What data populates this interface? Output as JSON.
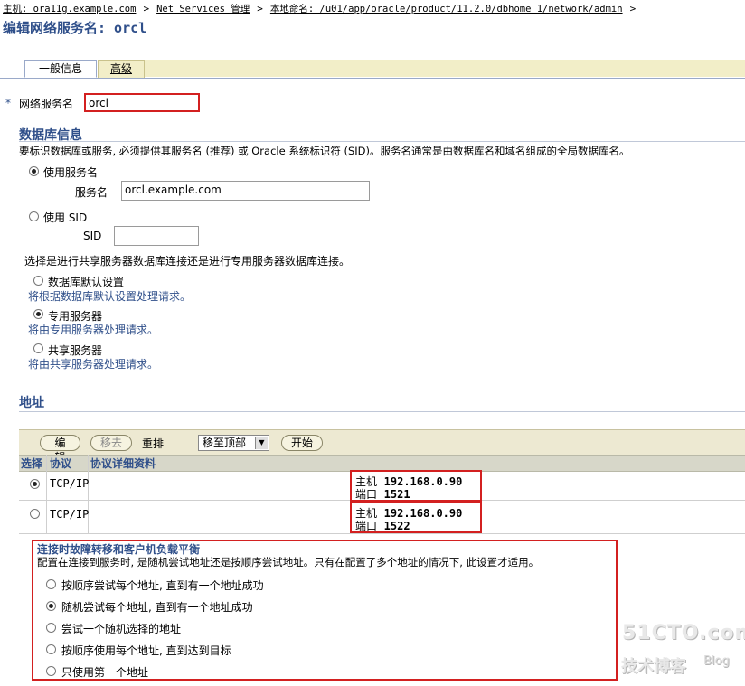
{
  "breadcrumb": {
    "host": "主机: ora11g.example.com",
    "netservices": "Net Services 管理",
    "naming": "本地命名: /u01/app/oracle/product/11.2.0/dbhome_1/network/admin",
    "sep": ">"
  },
  "page_title": "编辑网络服务名: orcl",
  "tabs": {
    "general": "一般信息",
    "advanced": "高级"
  },
  "service": {
    "required_mark": "*",
    "label": "网络服务名",
    "value": "orcl"
  },
  "db_info": {
    "title": "数据库信息",
    "description": "要标识数据库或服务, 必须提供其服务名 (推荐) 或 Oracle 系统标识符 (SID)。服务名通常是由数据库名和域名组成的全局数据库名。",
    "use_service_name": "使用服务名",
    "service_name_label": "服务名",
    "service_name_value": "orcl.example.com",
    "use_sid": "使用 SID",
    "sid_label": "SID",
    "sid_value": "",
    "connection_prompt": "选择是进行共享服务器数据库连接还是进行专用服务器数据库连接。",
    "options": [
      {
        "label": "数据库默认设置",
        "hint": "将根据数据库默认设置处理请求。",
        "selected": false
      },
      {
        "label": "专用服务器",
        "hint": "将由专用服务器处理请求。",
        "selected": true
      },
      {
        "label": "共享服务器",
        "hint": "将由共享服务器处理请求。",
        "selected": false
      }
    ]
  },
  "address": {
    "title": "地址",
    "toolbar": {
      "edit": "编辑",
      "remove": "移去",
      "reorder_label": "重排",
      "reorder_value": "移至顶部",
      "start": "开始"
    },
    "columns": [
      "选择",
      "协议",
      "协议详细资料"
    ],
    "rows": [
      {
        "protocol": "TCP/IP",
        "host_label": "主机",
        "host": "192.168.0.90",
        "port_label": "端口",
        "port": "1521",
        "selected": true
      },
      {
        "protocol": "TCP/IP",
        "host_label": "主机",
        "host": "192.168.0.90",
        "port_label": "端口",
        "port": "1522",
        "selected": false
      }
    ]
  },
  "load_balance": {
    "title": "连接时故障转移和客户机负载平衡",
    "description": "配置在连接到服务时, 是随机尝试地址还是按顺序尝试地址。只有在配置了多个地址的情况下, 此设置才适用。",
    "options": [
      {
        "label": "按顺序尝试每个地址, 直到有一个地址成功",
        "selected": false
      },
      {
        "label": "随机尝试每个地址, 直到有一个地址成功",
        "selected": true
      },
      {
        "label": "尝试一个随机选择的地址",
        "selected": false
      },
      {
        "label": "按顺序使用每个地址, 直到达到目标",
        "selected": false
      },
      {
        "label": "只使用第一个地址",
        "selected": false
      }
    ]
  },
  "watermark": {
    "line1": "51CTO.com",
    "line2": "技术博客",
    "line3": "Blog"
  }
}
